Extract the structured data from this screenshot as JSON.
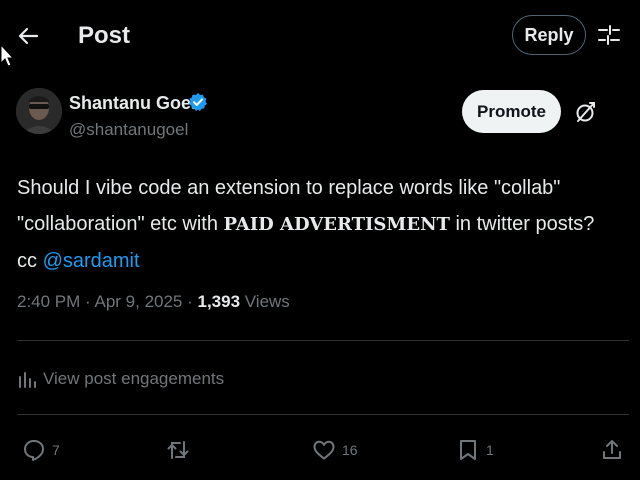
{
  "header": {
    "title": "Post",
    "reply_label": "Reply"
  },
  "author": {
    "name": "Shantanu Goel",
    "handle": "@shantanugoel",
    "promote_label": "Promote"
  },
  "post": {
    "line1": "Should I vibe code an extension to replace words like \"collab\"",
    "line2_start": "\"collaboration\" etc with ",
    "line2_bold": "PAID ADVERTISMENT",
    "line2_end": " in twitter posts?",
    "line3_start": "cc ",
    "mention": "@sardamit"
  },
  "meta": {
    "time": "2:40 PM",
    "sep1": " · ",
    "date": "Apr 9, 2025",
    "sep2": " · ",
    "views_count": "1,393",
    "views_label": " Views"
  },
  "engagements_label": "View post engagements",
  "actions": {
    "replies": "7",
    "likes": "16",
    "bookmarks": "1"
  },
  "colors": {
    "background": "#000000",
    "text": "#e7e9ea",
    "muted": "#71767b",
    "accent": "#1d9bf0",
    "divider": "#2f3336"
  },
  "icons": {
    "back": "arrow-left-icon",
    "settings": "sliders-icon",
    "verified": "verified-badge-icon",
    "grok": "grok-icon",
    "engagements": "bar-chart-icon",
    "reply": "comment-icon",
    "repost": "repost-icon",
    "like": "heart-icon",
    "bookmark": "bookmark-icon",
    "share": "share-icon"
  }
}
